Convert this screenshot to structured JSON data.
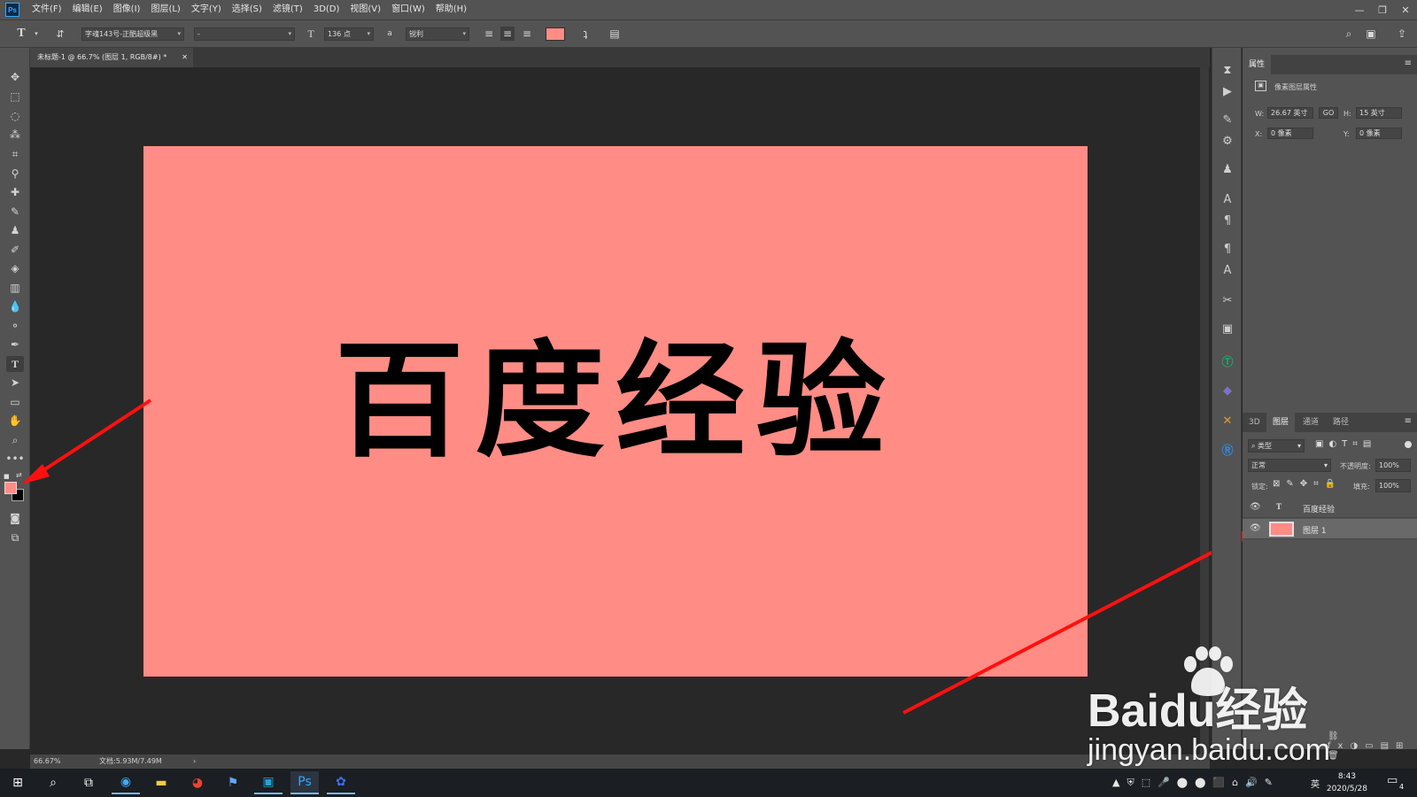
{
  "menubar": {
    "logo": "Ps",
    "items": [
      "文件(F)",
      "编辑(E)",
      "图像(I)",
      "图层(L)",
      "文字(Y)",
      "选择(S)",
      "滤镜(T)",
      "3D(D)",
      "视图(V)",
      "窗口(W)",
      "帮助(H)"
    ]
  },
  "options": {
    "font_family": "字魂143号-正酷超级黑",
    "font_style": "-",
    "font_size": "136 点",
    "antialias": "锐利",
    "text_color": "#ff8c85"
  },
  "document": {
    "tab_title": "未标题-1 @ 66.7% (图层 1, RGB/8#) *",
    "canvas_text": "百度经验",
    "canvas_color": "#ff8c85"
  },
  "status": {
    "zoom": "66.67%",
    "doc_size": "文档:5.93M/7.49M"
  },
  "properties": {
    "tab": "属性",
    "header": "像素图层属性",
    "w_label": "W:",
    "w_value": "26.67 英寸",
    "link": "GO",
    "h_label": "H:",
    "h_value": "15 英寸",
    "x_label": "X:",
    "x_value": "0 像素",
    "y_label": "Y:",
    "y_value": "0 像素"
  },
  "layers": {
    "tabs": [
      "3D",
      "图层",
      "通道",
      "路径"
    ],
    "filter": "类型",
    "blend_mode": "正常",
    "opacity_label": "不透明度:",
    "opacity": "100%",
    "lock_label": "锁定:",
    "fill_label": "填充:",
    "fill": "100%",
    "items": [
      {
        "name": "百度经验",
        "type": "T"
      },
      {
        "name": "图层 1",
        "type": "pixel",
        "thumb": "#ff8c85"
      }
    ]
  },
  "taskbar": {
    "time": "8:43",
    "date": "2020/5/28",
    "ime": "英",
    "notification_count": "4"
  },
  "watermark": {
    "brand": "Baidu经验",
    "url": "jingyan.baidu.com"
  }
}
